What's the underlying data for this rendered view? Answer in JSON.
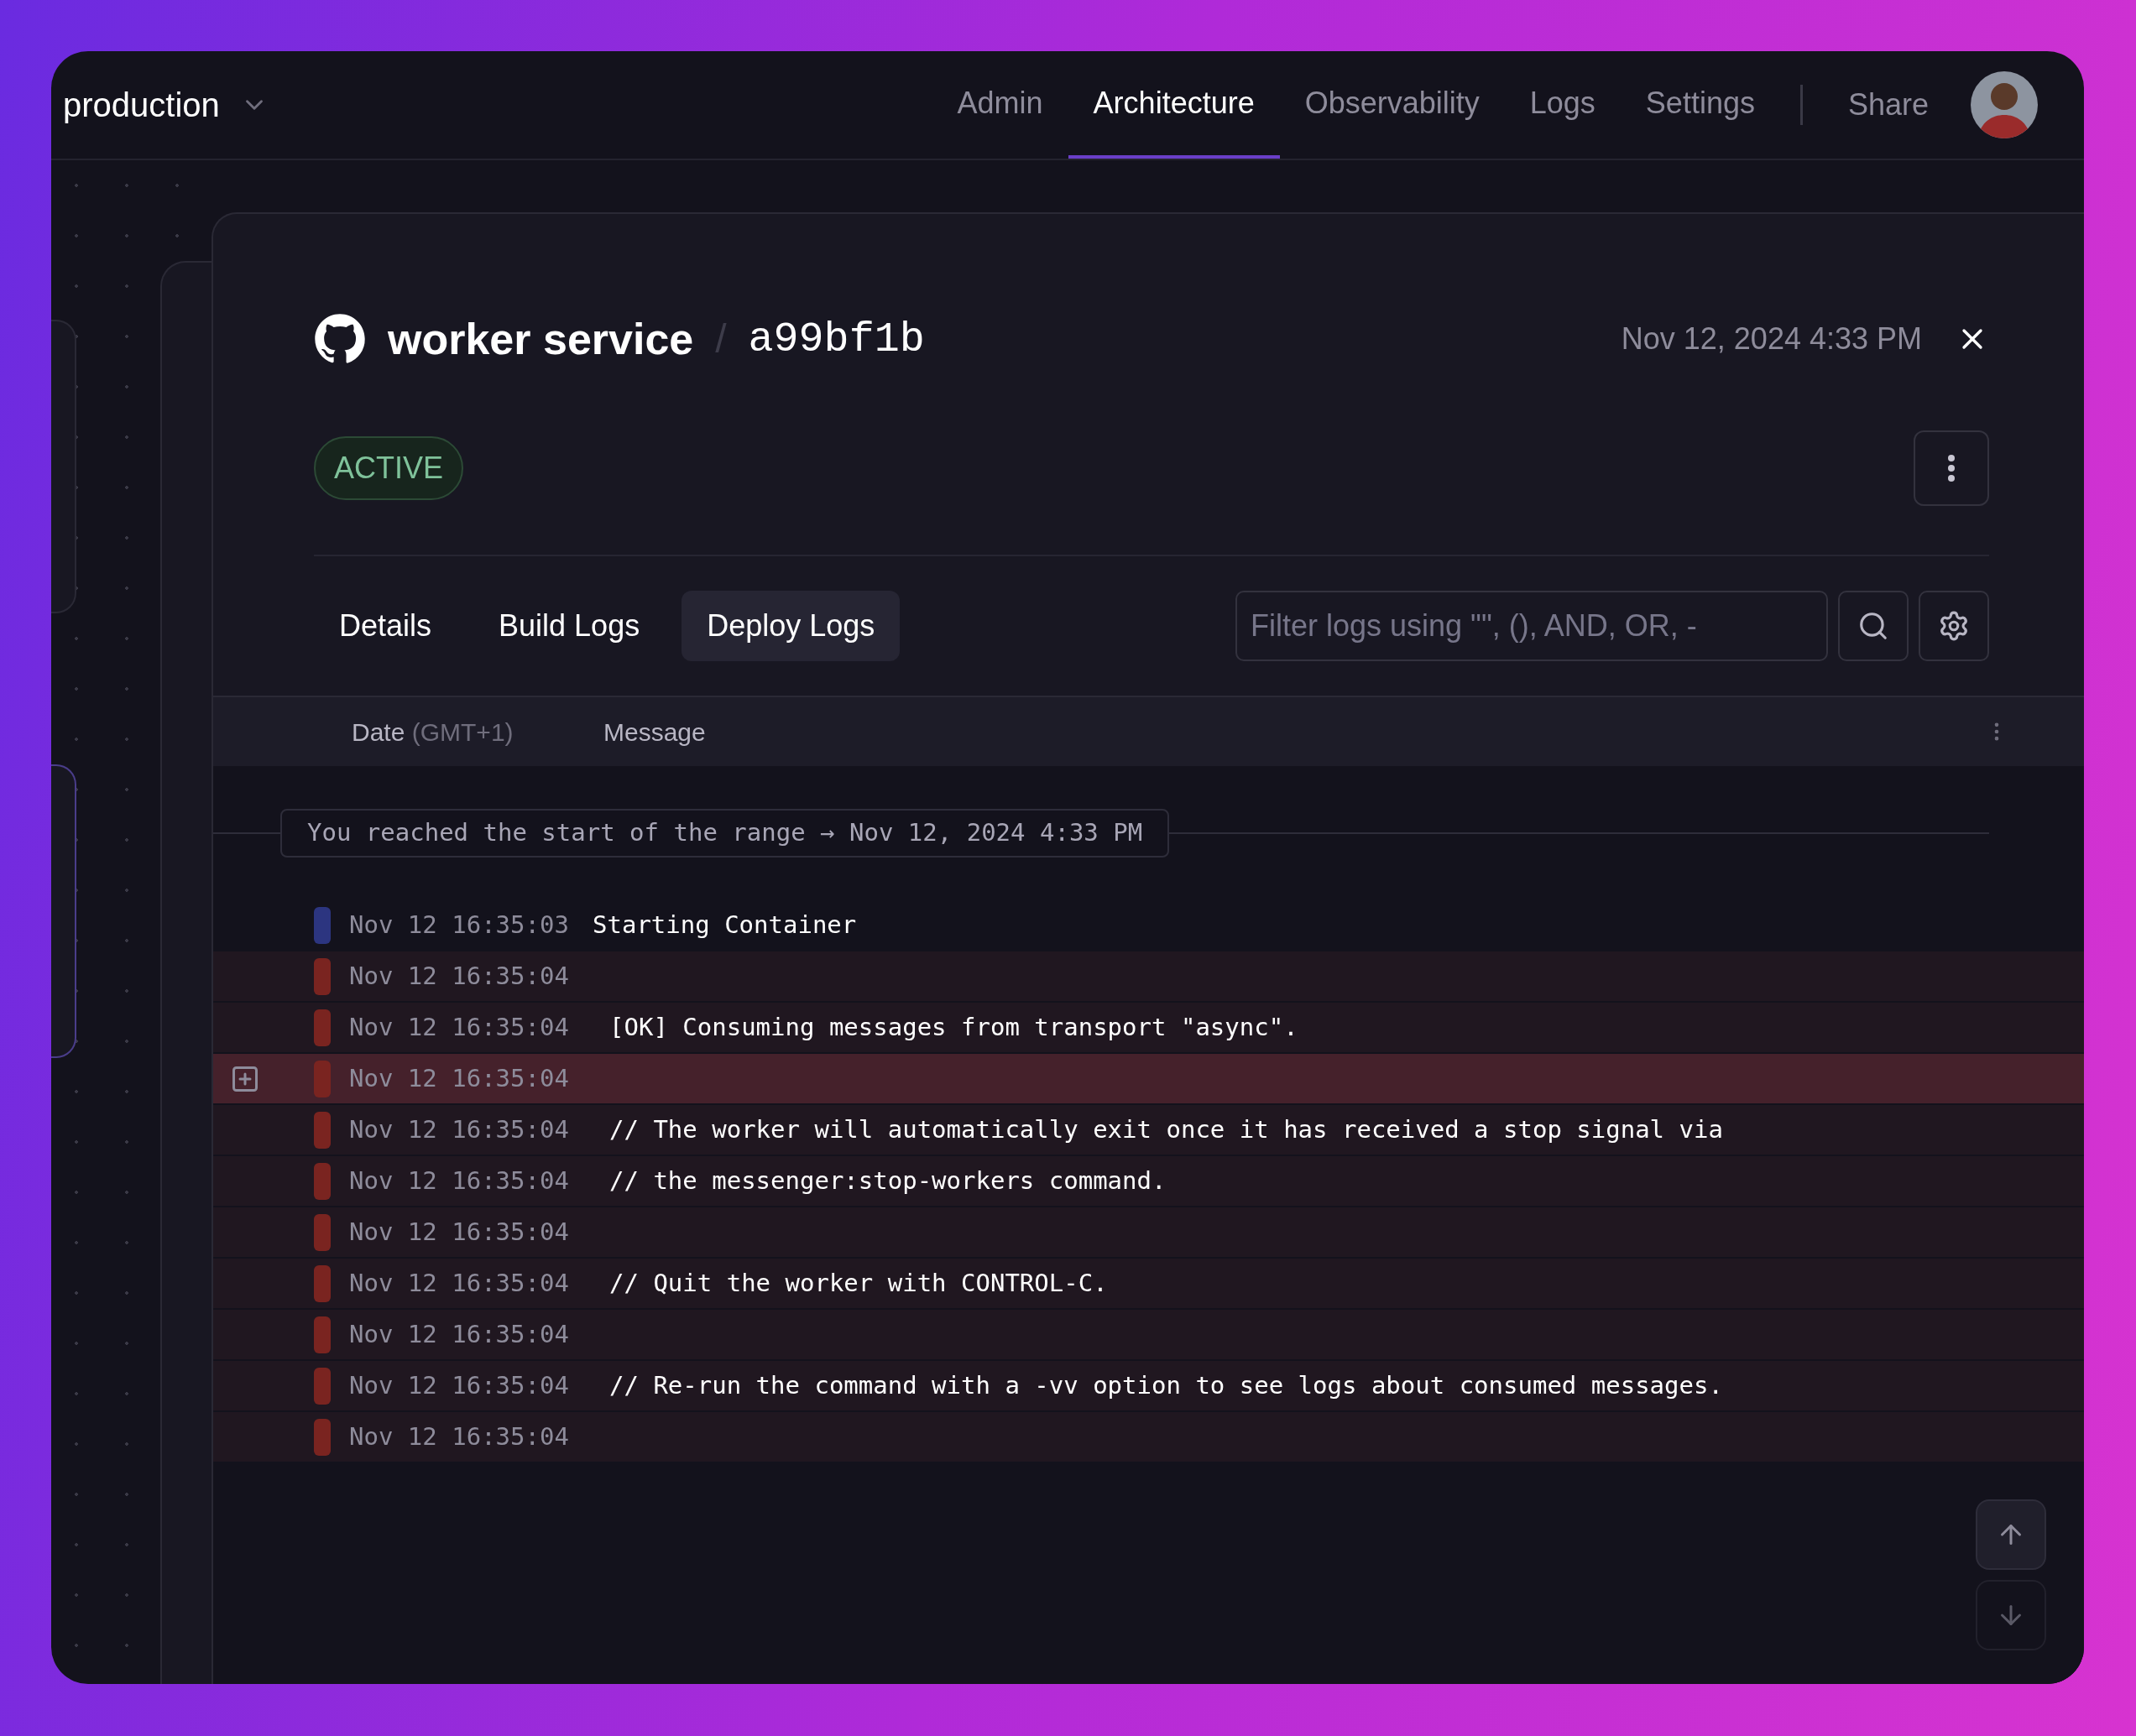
{
  "project": {
    "name": "production"
  },
  "nav": [
    {
      "label": "Admin",
      "selected": false
    },
    {
      "label": "Architecture",
      "selected": true
    },
    {
      "label": "Observability",
      "selected": false
    },
    {
      "label": "Logs",
      "selected": false
    },
    {
      "label": "Settings",
      "selected": false
    }
  ],
  "share": "Share",
  "deployment": {
    "service": "worker service",
    "separator": "/",
    "commit": "a99bf1b",
    "date": "Nov 12, 2024 4:33 PM",
    "status": "ACTIVE"
  },
  "tabs": [
    {
      "label": "Details",
      "selected": false
    },
    {
      "label": "Build Logs",
      "selected": false
    },
    {
      "label": "Deploy Logs",
      "selected": true
    }
  ],
  "filter": {
    "placeholder": "Filter logs using \"\", (), AND, OR, -"
  },
  "columns": {
    "date": "Date",
    "timezone": "(GMT+1)",
    "message": "Message"
  },
  "range_marker": "You reached the start of the range → Nov 12, 2024 4:33 PM",
  "logs": [
    {
      "kind": "info",
      "color": "#2c3580",
      "time": "Nov 12 16:35:03",
      "message": "Starting Container",
      "selected": false
    },
    {
      "kind": "error",
      "color": "#7a2420",
      "time": "Nov 12 16:35:04",
      "selected": false
    },
    {
      "kind": "error",
      "color": "#7a2420",
      "time": "Nov 12 16:35:04",
      "message": "[OK] Consuming messages from transport \"async\".",
      "selected": false
    },
    {
      "kind": "error",
      "color": "#7a2420",
      "time": "Nov 12 16:35:04",
      "selected": true
    },
    {
      "kind": "error",
      "color": "#7a2420",
      "time": "Nov 12 16:35:04",
      "message": "// The worker will automatically exit once it has received a stop signal via",
      "selected": false
    },
    {
      "kind": "error",
      "color": "#7a2420",
      "time": "Nov 12 16:35:04",
      "message": "// the messenger:stop-workers command.",
      "selected": false
    },
    {
      "kind": "error",
      "color": "#7a2420",
      "time": "Nov 12 16:35:04",
      "selected": false
    },
    {
      "kind": "error",
      "color": "#7a2420",
      "time": "Nov 12 16:35:04",
      "message": "// Quit the worker with CONTROL-C.",
      "selected": false
    },
    {
      "kind": "error",
      "color": "#7a2420",
      "time": "Nov 12 16:35:04",
      "selected": false
    },
    {
      "kind": "error",
      "color": "#7a2420",
      "time": "Nov 12 16:35:04",
      "message": "// Re-run the command with a -vv option to see logs about consumed messages.",
      "selected": false
    },
    {
      "kind": "error",
      "color": "#7a2420",
      "time": "Nov 12 16:35:04",
      "selected": false
    }
  ]
}
